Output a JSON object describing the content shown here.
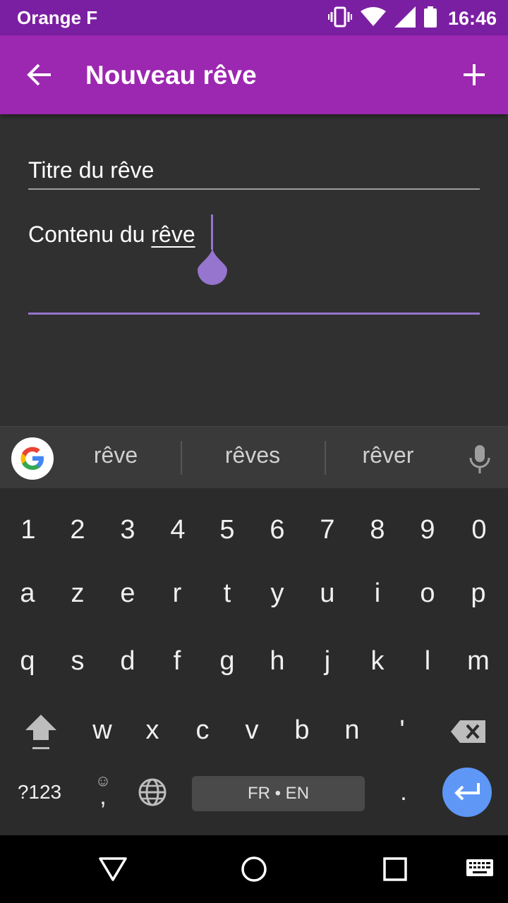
{
  "status_bar": {
    "carrier": "Orange F",
    "time": "16:46",
    "icons": [
      "vibrate-icon",
      "wifi-icon",
      "signal-icon",
      "battery-icon"
    ]
  },
  "app_bar": {
    "title": "Nouveau rêve",
    "back_icon": "arrow-back-icon",
    "add_icon": "plus-icon",
    "color": "#9c27b0"
  },
  "form": {
    "title_placeholder": "Titre du rêve",
    "content_prefix": "Contenu du ",
    "content_word": "rêve",
    "accent_color": "#9575cd"
  },
  "keyboard": {
    "suggestions": [
      "rêve",
      "rêves",
      "rêver"
    ],
    "number_row": [
      "1",
      "2",
      "3",
      "4",
      "5",
      "6",
      "7",
      "8",
      "9",
      "0"
    ],
    "row1": [
      "a",
      "z",
      "e",
      "r",
      "t",
      "y",
      "u",
      "i",
      "o",
      "p"
    ],
    "row2": [
      "q",
      "s",
      "d",
      "f",
      "g",
      "h",
      "j",
      "k",
      "l",
      "m"
    ],
    "row3": [
      "w",
      "x",
      "c",
      "v",
      "b",
      "n",
      "'"
    ],
    "symbols_label": "?123",
    "comma": ",",
    "period": ".",
    "space_label": "FR • EN",
    "enter_color": "#5e97f6"
  },
  "nav_bar": {
    "icons": [
      "back-triangle-icon",
      "home-circle-icon",
      "recents-square-icon",
      "keyboard-switch-icon"
    ]
  }
}
